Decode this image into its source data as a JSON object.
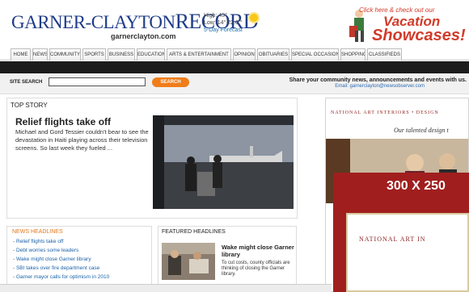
{
  "masthead": {
    "title_part1": "GARNER-CLAYTON",
    "title_part2": "RECORD",
    "url": "garnerclayton.com",
    "weather": {
      "high": "High: 43°",
      "low_temp": "Low:  14° 22.0 °",
      "forecast_link": "5-Day Forecast"
    }
  },
  "top_ad": {
    "line1": "Click here & check out our",
    "line2": "Vacation",
    "line3": "Showcases!"
  },
  "nav": {
    "items": [
      "HOME",
      "NEWS",
      "COMMUNITY",
      "SPORTS",
      "BUSINESS",
      "EDUCATION",
      "ARTS & ENTERTAINMENT",
      "OPINION",
      "OBITUARIES",
      "SPECIAL OCCASIONS",
      "SHOPPING",
      "CLASSIFIEDS"
    ]
  },
  "search": {
    "label": "SITE SEARCH",
    "value": "",
    "button": "SEARCH",
    "share_text": "Share your community news, announcements and events with us.",
    "email_text": "Email: garnerclayton@newsobserver.com"
  },
  "top_story": {
    "heading": "TOP STORY",
    "title": "Relief flights take off",
    "body": "Michael and Gord Tessier couldn't bear to see the devastation in Haiti playing across their television screens. So last week they fueled ..."
  },
  "news_headlines": {
    "heading": "NEWS HEADLINES",
    "items": [
      "- Relief flights take off",
      "- Debt worries some leaders",
      "- Wake might close Garner library",
      "- SBI takes over fire department case",
      "- Garner mayor calls for optimism in 2010"
    ]
  },
  "featured": {
    "heading": "FEATURED HEADLINES",
    "title": "Wake might close Garner library",
    "desc": "To cut costs, county officials are thinking of closing the Garner library."
  },
  "right_ad": {
    "header": "NATIONAL ART INTERIORS • DESIGN",
    "tagline": "Our talented design t"
  },
  "overlay_ad": {
    "size_label": "300 X 250",
    "inner_header": "NATIONAL ART IN"
  },
  "colors": {
    "brand": "#1f3c88",
    "accent": "#ef7d1a",
    "link": "#1a62a8",
    "ad_red": "#a11e1e"
  }
}
